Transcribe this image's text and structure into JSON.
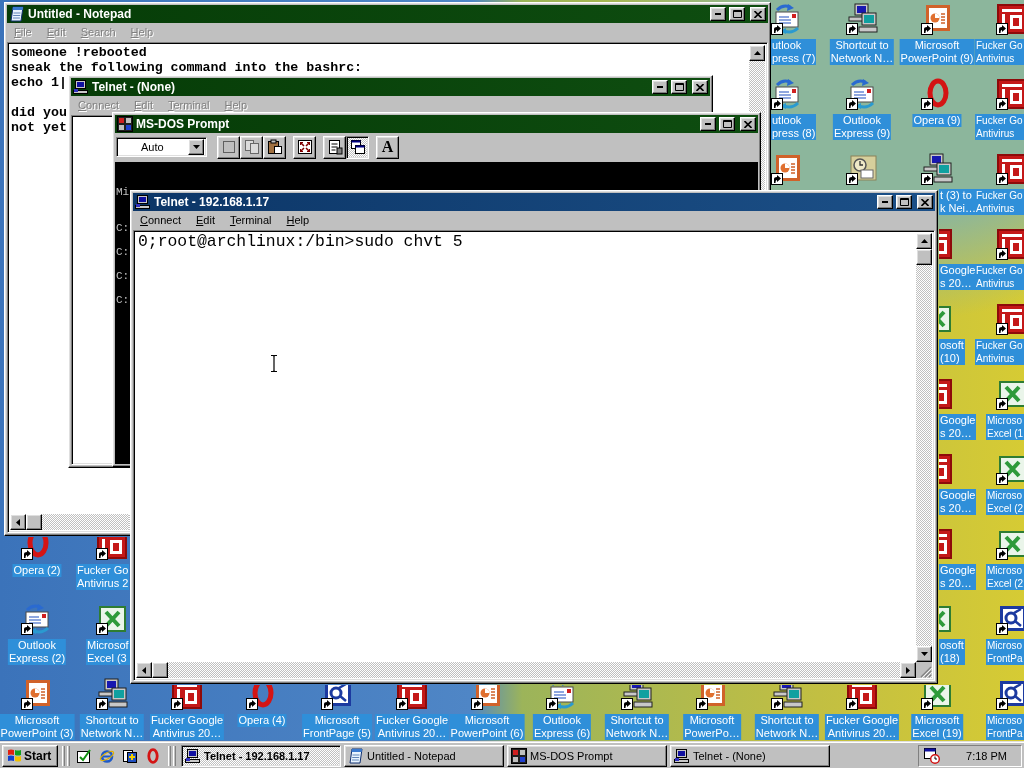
{
  "desktop": {
    "icons": [
      {
        "kind": "outlook",
        "label": "utlook\npress (7)"
      },
      {
        "kind": "network",
        "label": "Shortcut to\nNetwork N…"
      },
      {
        "kind": "powerpoint",
        "label": "Microsoft\nPowerPoint (9)"
      },
      {
        "kind": "fg",
        "label": "Fucker Go\nAntivirus"
      },
      {
        "kind": "outlook",
        "label": "utlook\npress (8)"
      },
      {
        "kind": "outlook",
        "label": "Outlook\nExpress (9)"
      },
      {
        "kind": "opera",
        "label": "Opera (9)"
      },
      {
        "kind": "fg",
        "label": "Fucker Go\nAntivirus"
      },
      {
        "kind": "powerpoint"
      },
      {
        "kind": "scheduler"
      },
      {
        "kind": "network",
        "label": "t (3) to\nk Nei…"
      },
      {
        "kind": "fg",
        "label": "Fucker Go\nAntivirus"
      },
      {
        "kind": "fg",
        "label": "Google\ns 20…"
      },
      {
        "kind": "fg",
        "label": "Fucker Go\nAntivirus"
      },
      {
        "kind": "excel",
        "label": "osoft\n(10)"
      },
      {
        "kind": "fg",
        "label": "Fucker Go\nAntivirus"
      },
      {
        "kind": "fg",
        "label": "Google\ns 20…"
      },
      {
        "kind": "excel",
        "label": "Microso\nExcel (1"
      },
      {
        "kind": "fg",
        "label": "Google\ns 20…"
      },
      {
        "kind": "excel",
        "label": "Microso\nExcel (2"
      },
      {
        "kind": "opera",
        "label": "Opera (2)"
      },
      {
        "kind": "fg",
        "label": "Fucker Go\nAntivirus 2"
      },
      {
        "kind": "fg",
        "label": "Google\ns 20…"
      },
      {
        "kind": "excel",
        "label": "Microso\nExcel (2"
      },
      {
        "kind": "outlook",
        "label": "Outlook\nExpress (2)"
      },
      {
        "kind": "excel",
        "label": "Microsof\nExcel (3"
      },
      {
        "kind": "excel",
        "label": "osoft\n(18)"
      },
      {
        "kind": "frontpage",
        "label": "Microso\nFrontPa"
      },
      {
        "kind": "powerpoint",
        "label": "Microsoft\nPowerPoint (3)"
      },
      {
        "kind": "network",
        "label": "Shortcut to\nNetwork N…"
      },
      {
        "kind": "fg",
        "label": "Fucker Google\nAntivirus 20…"
      },
      {
        "kind": "opera",
        "label": "Opera (4)"
      },
      {
        "kind": "frontpage",
        "label": "Microsoft\nFrontPage (5)"
      },
      {
        "kind": "fg",
        "label": "Fucker Google\nAntivirus 20…"
      },
      {
        "kind": "powerpoint",
        "label": "Microsoft\nPowerPoint (6)"
      },
      {
        "kind": "outlook",
        "label": "Outlook\nExpress (6)"
      },
      {
        "kind": "network",
        "label": "Shortcut to\nNetwork N…"
      },
      {
        "kind": "powerpoint",
        "label": "Microsoft\nPowerPo…"
      },
      {
        "kind": "network",
        "label": "Shortcut to\nNetwork N…"
      },
      {
        "kind": "fg",
        "label": "Fucker Google\nAntivirus 20…"
      },
      {
        "kind": "excel",
        "label": "Microsoft\nExcel (19)"
      },
      {
        "kind": "frontpage",
        "label": "Microso\nFrontPa"
      }
    ]
  },
  "windows": [
    {
      "kind": "notepad",
      "title": "Untitled - Notepad",
      "active": false,
      "menu": [
        {
          "label": "File",
          "disabled": true
        },
        {
          "label": "Edit",
          "disabled": true
        },
        {
          "label": "Search",
          "disabled": true
        },
        {
          "label": "Help",
          "disabled": true
        }
      ],
      "paragraphs": [
        [
          "someone !rebooted",
          "sneak the following command into the bashrc:",
          "echo 1|"
        ],
        [
          "did you",
          "not yet"
        ]
      ]
    },
    {
      "kind": "telnet",
      "title": "Telnet - (None)",
      "active": false,
      "menu": [
        {
          "label": "Connect",
          "disabled": true
        },
        {
          "label": "Edit",
          "disabled": true
        },
        {
          "label": "Terminal",
          "disabled": true
        },
        {
          "label": "Help",
          "disabled": true
        }
      ]
    },
    {
      "kind": "dos",
      "title": "MS-DOS Prompt",
      "active": false,
      "toolbar": {
        "font_size": "Auto",
        "buttons": [
          {
            "kind": "mark",
            "disabled": false,
            "pressed": false
          },
          {
            "kind": "copy",
            "disabled": true,
            "pressed": false
          },
          {
            "kind": "paste",
            "disabled": false,
            "pressed": false
          },
          {
            "kind": "fullscreen",
            "disabled": false,
            "pressed": false
          },
          {
            "kind": "properties",
            "disabled": false,
            "pressed": false
          },
          {
            "kind": "background",
            "disabled": false,
            "pressed": true
          },
          {
            "kind": "font",
            "label": "A",
            "disabled": false,
            "pressed": false
          }
        ]
      },
      "lines": [
        "Mi",
        "C:",
        "C:",
        "C:",
        "C:"
      ]
    },
    {
      "kind": "telnet",
      "title": "Telnet - 192.168.1.17",
      "active": true,
      "menu": [
        {
          "label": "Connect",
          "disabled": false
        },
        {
          "label": "Edit",
          "disabled": false
        },
        {
          "label": "Terminal",
          "disabled": false
        },
        {
          "label": "Help",
          "disabled": false
        }
      ],
      "lines": [
        "0;root@archlinux:/bin>sudo chvt 5"
      ]
    }
  ],
  "taskbar": {
    "start_label": "Start",
    "quick_launch": [
      {
        "kind": "desk"
      },
      {
        "kind": "browser"
      },
      {
        "kind": "channels"
      },
      {
        "kind": "opera"
      }
    ],
    "tasks": [
      {
        "kind": "telnet",
        "label": "Telnet - 192.168.1.17",
        "selected": true
      },
      {
        "kind": "notepad",
        "label": "Untitled - Notepad",
        "selected": false
      },
      {
        "kind": "dos",
        "label": "MS-DOS Prompt",
        "selected": false
      },
      {
        "kind": "telnet",
        "label": "Telnet - (None)",
        "selected": false
      }
    ],
    "tray": [
      {
        "kind": "scheduler"
      }
    ],
    "clock": "7:18 PM"
  }
}
